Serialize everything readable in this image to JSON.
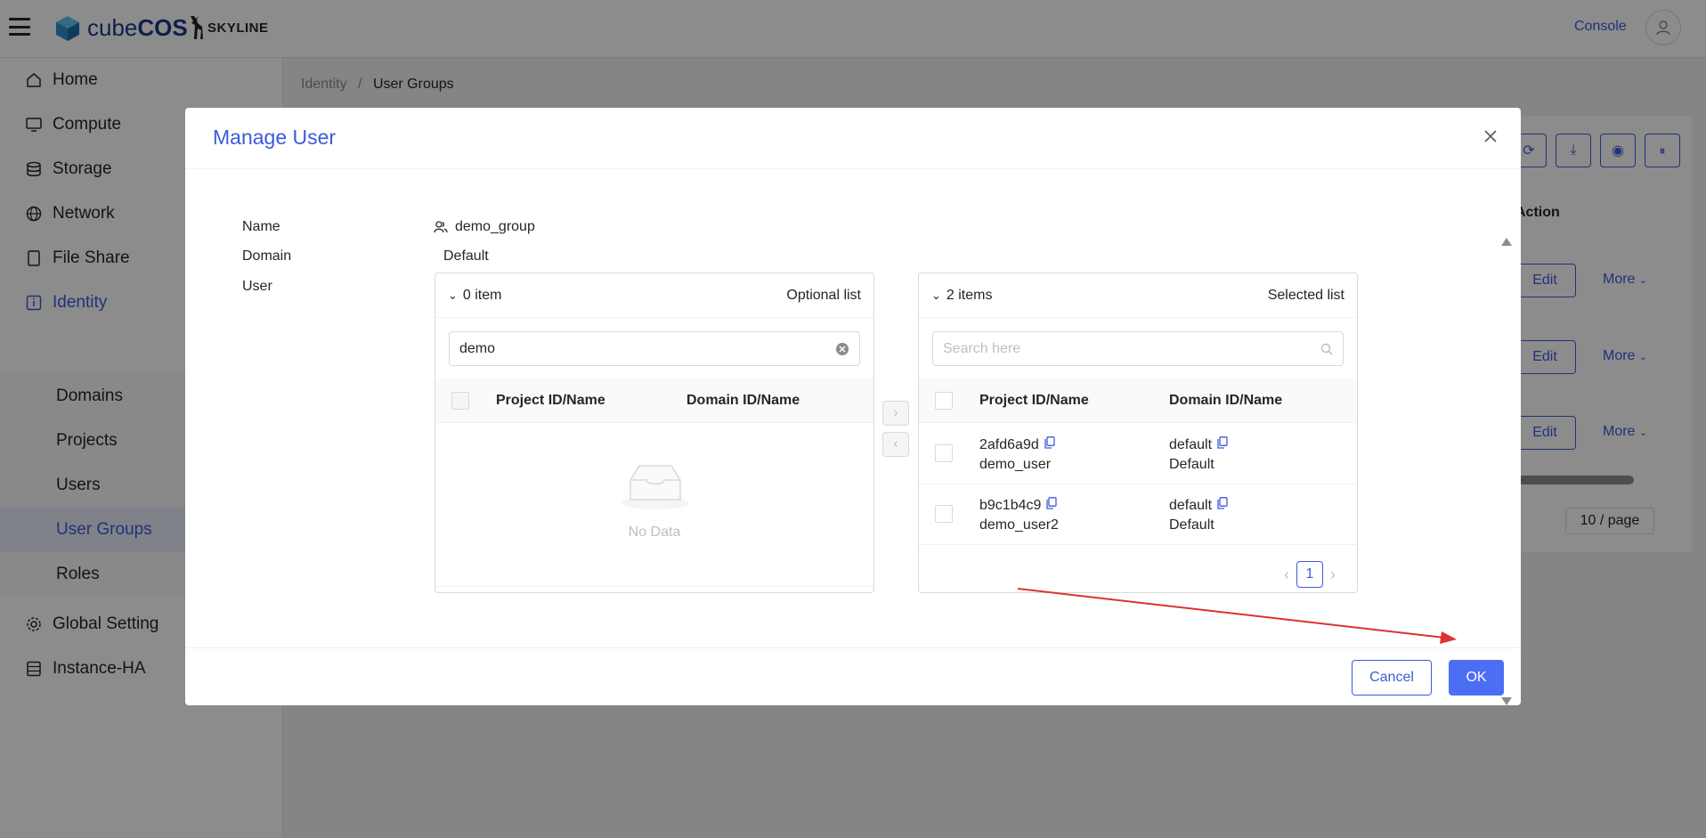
{
  "app": {
    "brand": "cubeCOS",
    "brand_light": "cube",
    "brand_bold": "COS",
    "partner": "SKYLINE",
    "console_label": "Console"
  },
  "sidebar": {
    "items": [
      {
        "label": "Home",
        "icon": "home-icon"
      },
      {
        "label": "Compute",
        "icon": "monitor-icon"
      },
      {
        "label": "Storage",
        "icon": "database-icon"
      },
      {
        "label": "Network",
        "icon": "globe-icon"
      },
      {
        "label": "File Share",
        "icon": "file-icon"
      },
      {
        "label": "Identity",
        "icon": "info-icon"
      },
      {
        "label": "Global Setting",
        "icon": "gear-icon"
      },
      {
        "label": "Instance-HA",
        "icon": "server-icon"
      }
    ],
    "identity_sub": [
      {
        "label": "Domains"
      },
      {
        "label": "Projects"
      },
      {
        "label": "Users"
      },
      {
        "label": "User Groups"
      },
      {
        "label": "Roles"
      }
    ]
  },
  "breadcrumb": {
    "parent": "Identity",
    "separator": "/",
    "current": "User Groups"
  },
  "background_table": {
    "action_header": "Action",
    "rows": [
      {
        "edit": "Edit",
        "more": "More"
      },
      {
        "edit": "Edit",
        "more": "More"
      },
      {
        "edit": "Edit",
        "more": "More"
      }
    ],
    "page": "1",
    "page_size": "10 / page"
  },
  "modal": {
    "title": "Manage User",
    "fields": {
      "name_label": "Name",
      "name_value": "demo_group",
      "domain_label": "Domain",
      "domain_value": "Default",
      "user_label": "User"
    },
    "left_list": {
      "count": "0 item",
      "title": "Optional list",
      "search_value": "demo",
      "col1": "Project ID/Name",
      "col2": "Domain ID/Name",
      "empty": "No Data"
    },
    "right_list": {
      "count": "2 items",
      "title": "Selected list",
      "search_placeholder": "Search here",
      "col1": "Project ID/Name",
      "col2": "Domain ID/Name",
      "rows": [
        {
          "id": "2afd6a9d",
          "name": "demo_user",
          "domain_id": "default",
          "domain_name": "Default"
        },
        {
          "id": "b9c1b4c9",
          "name": "demo_user2",
          "domain_id": "default",
          "domain_name": "Default"
        }
      ],
      "page": "1"
    },
    "cancel_label": "Cancel",
    "ok_label": "OK"
  },
  "colors": {
    "accent": "#3b5bdb",
    "primary_button": "#4c6ef5",
    "annotation_arrow": "#e03131"
  }
}
